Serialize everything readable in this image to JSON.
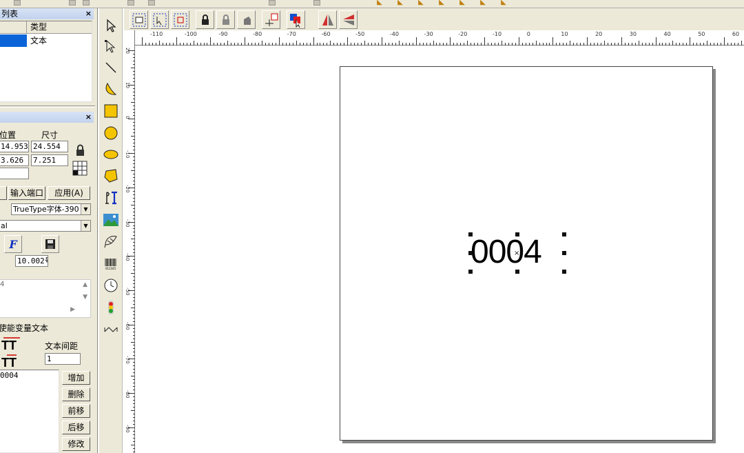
{
  "object_list": {
    "title": "列表",
    "close": "×",
    "column_type": "类型",
    "rows": [
      {
        "type": "文本"
      }
    ]
  },
  "properties": {
    "close": "×",
    "position_label": "位置",
    "size_label": "尺寸",
    "x_value": "14.953",
    "w_value": "24.554",
    "y_value": "3.626",
    "h_value": "7.251",
    "input_port_button": "输入端口",
    "apply_button": "应用(A)",
    "font_type": "TrueType字体-390",
    "font_name": "al",
    "height_value": "10.002号",
    "text_preview": "4",
    "enable_variable_text": "使能变量文本",
    "text_spacing_label": "文本间距",
    "text_spacing_value": "1",
    "variable_list": [
      "0004"
    ],
    "add_button": "增加",
    "delete_button": "删除",
    "move_up_button": "前移",
    "move_down_button": "后移",
    "modify_button": "修改"
  },
  "ruler_top": {
    "labels": [
      "-110",
      "-100",
      "-90",
      "-80",
      "-70",
      "-60",
      "-50",
      "-40",
      "-30",
      "-20",
      "-10",
      "0",
      "10",
      "20",
      "30",
      "40",
      "50",
      "60"
    ]
  },
  "ruler_left": {
    "labels": [
      "20",
      "10",
      "0",
      "-10",
      "-20",
      "-30",
      "-40",
      "-50",
      "-60",
      "-70",
      "-80",
      "-90"
    ]
  },
  "canvas": {
    "text": "0004"
  },
  "colors": {
    "chrome": "#ece9d8",
    "panel_header": "#c2d3ee",
    "selection": "#0a64d8",
    "canvas": "#ffffff"
  }
}
